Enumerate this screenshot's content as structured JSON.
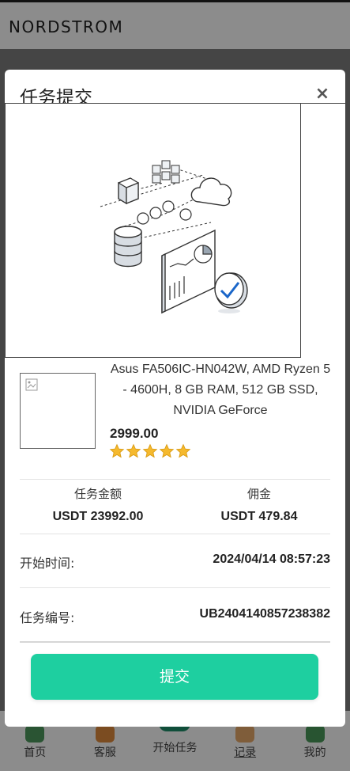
{
  "header": {
    "brand": "NORDSTROM"
  },
  "modal": {
    "title": "任务提交",
    "close_icon": "×",
    "product": {
      "name": "Asus FA506IC-HN042W, AMD Ryzen 5 - 4600H, 8 GB RAM, 512 GB SSD, NVIDIA GeForce",
      "price": "2999.00",
      "rating": 5
    },
    "stats": {
      "amount_label": "任务金额",
      "amount_value": "USDT  23992.00",
      "commission_label": "佣金",
      "commission_value": "USDT  479.84"
    },
    "start_time": {
      "label": "开始时间:",
      "value": "2024/04/14 08:57:23"
    },
    "task_no": {
      "label": "任务编号:",
      "value": "UB2404140857238382"
    },
    "submit_label": "提交"
  },
  "nav": {
    "items": [
      {
        "label": "首页"
      },
      {
        "label": "客服"
      },
      {
        "label": "开始任务"
      },
      {
        "label": "记录"
      },
      {
        "label": "我的"
      }
    ]
  },
  "colors": {
    "accent": "#1ecfa0",
    "star": "#f5b92e"
  }
}
